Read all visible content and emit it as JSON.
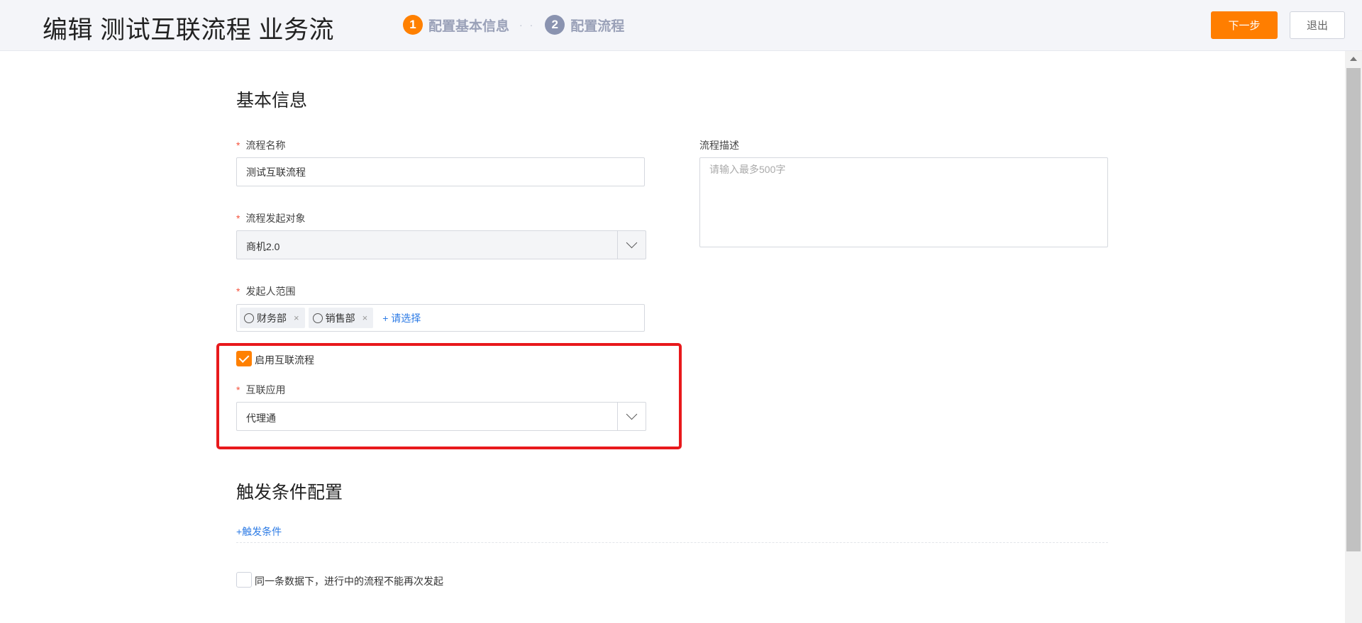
{
  "header": {
    "title": "编辑 测试互联流程 业务流",
    "steps": [
      {
        "number": "1",
        "label": "配置基本信息"
      },
      {
        "number": "2",
        "label": "配置流程"
      }
    ],
    "step_separator": "· ·",
    "next_button": "下一步",
    "exit_button": "退出"
  },
  "basic_info": {
    "section_title": "基本信息",
    "required_mark": "*",
    "process_name": {
      "label": "流程名称",
      "value": "测试互联流程"
    },
    "process_description": {
      "label": "流程描述",
      "placeholder": "请输入最多500字"
    },
    "initiating_object": {
      "label": "流程发起对象",
      "value": "商机2.0"
    },
    "initiator_scope": {
      "label": "发起人范围",
      "tags": [
        "财务部",
        "销售部"
      ],
      "tag_close": "×",
      "add_link": "+ 请选择"
    },
    "enable_interconnect": {
      "label": "启用互联流程",
      "checked": true
    },
    "interconnect_app": {
      "label": "互联应用",
      "value": "代理通"
    }
  },
  "trigger_config": {
    "section_title": "触发条件配置",
    "add_trigger": "+触发条件",
    "no_reinitiate": {
      "label": "同一条数据下，进行中的流程不能再次发起",
      "checked": false
    }
  },
  "colors": {
    "accent": "#ff8000",
    "link": "#2d7be5",
    "highlight_border": "#e8191c",
    "required": "#f5533d"
  }
}
